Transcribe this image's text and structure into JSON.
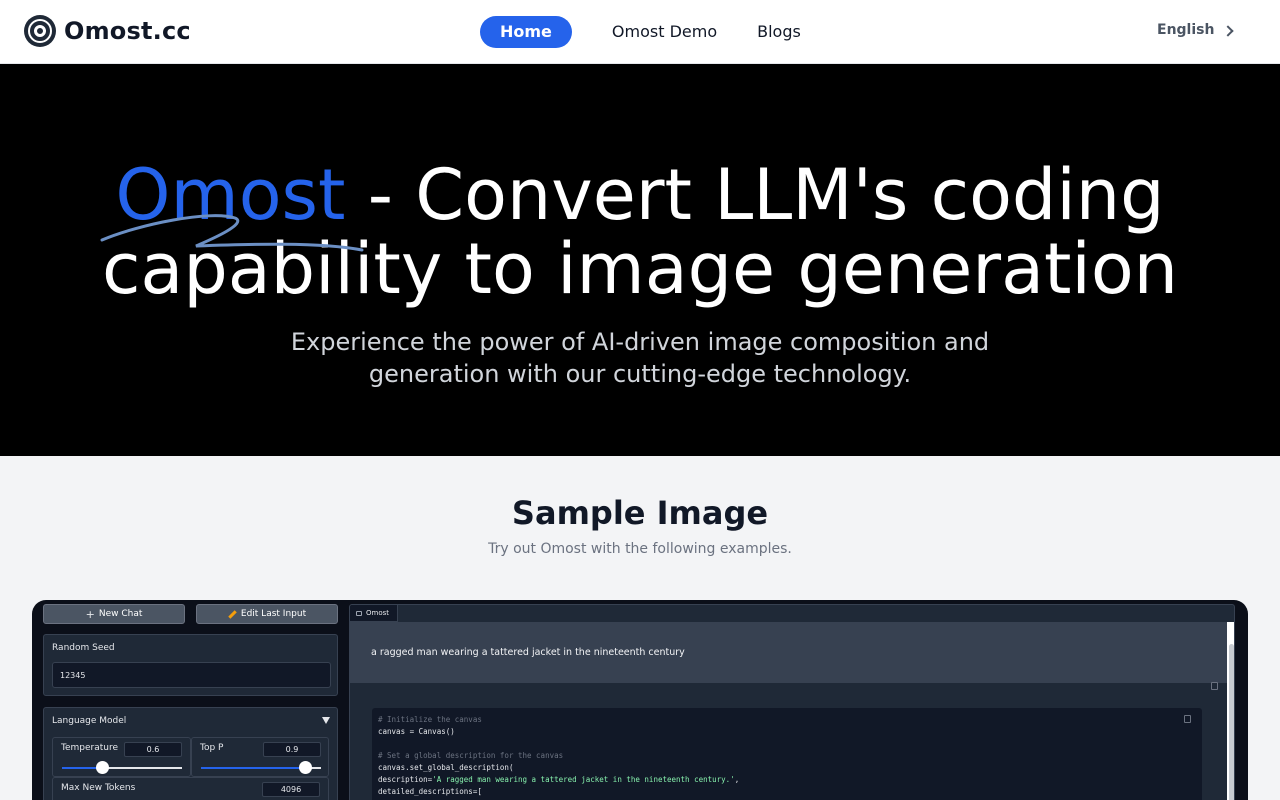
{
  "nav": {
    "brand": "Omost.cc",
    "links": [
      "Home",
      "Omost Demo",
      "Blogs"
    ],
    "active_index": 0,
    "language": "English"
  },
  "hero": {
    "title_accent": "Omost",
    "title_line1_rest": " - Convert LLM's coding",
    "title_line2": "capability to image generation",
    "subtitle": "Experience the power of AI-driven image composition and generation with our cutting-edge technology."
  },
  "sample": {
    "title": "Sample Image",
    "subtitle": "Try out Omost with the following examples."
  },
  "demo": {
    "buttons": {
      "new_chat": "New Chat",
      "edit_last": "Edit Last Input"
    },
    "random_seed": {
      "label": "Random Seed",
      "value": "12345"
    },
    "language_model": {
      "label": "Language Model",
      "temperature": {
        "label": "Temperature",
        "value": "0.6",
        "fraction": 0.33
      },
      "top_p": {
        "label": "Top P",
        "value": "0.9",
        "fraction": 0.87
      },
      "max_new_tokens": {
        "label": "Max New Tokens",
        "value": "4096"
      }
    },
    "chat": {
      "tab": "Omost",
      "user_message": "a ragged man wearing a tattered jacket in the nineteenth century",
      "code_lines": [
        "# Initialize the canvas",
        "canvas = Canvas()",
        "",
        "# Set a global description for the canvas",
        "canvas.set_global_description(",
        "    description='A ragged man wearing a tattered jacket in the nineteenth century.',",
        "    detailed_descriptions=["
      ]
    }
  },
  "colors": {
    "accent": "#2563eb",
    "hero_bg": "#000000",
    "page_bg": "#f3f4f6"
  }
}
